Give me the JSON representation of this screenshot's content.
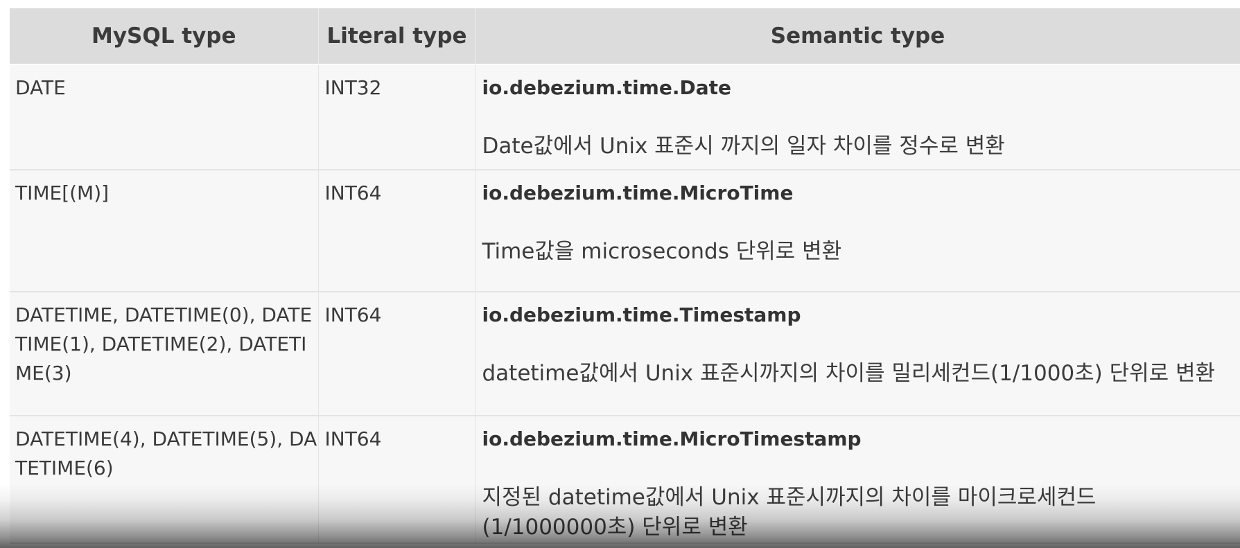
{
  "table": {
    "headers": {
      "mysql_type": "MySQL type",
      "literal_type": "Literal type",
      "semantic_type": "Semantic type"
    },
    "rows": [
      {
        "mysql_type": "DATE",
        "literal_type": "INT32",
        "semantic_name": "io.debezium.time.Date",
        "semantic_desc": "Date값에서 Unix 표준시 까지의 일자 차이를 정수로 변환"
      },
      {
        "mysql_type": "TIME[(M)]",
        "literal_type": "INT64",
        "semantic_name": "io.debezium.time.MicroTime",
        "semantic_desc": "Time값을 microseconds 단위로 변환"
      },
      {
        "mysql_type": "DATETIME, DATETIME(0), DATETIME(1), DATETIME(2), DATETIME(3)",
        "literal_type": "INT64",
        "semantic_name": "io.debezium.time.Timestamp",
        "semantic_desc": "datetime값에서 Unix 표준시까지의 차이를 밀리세컨드(1/1000초) 단위로 변환"
      },
      {
        "mysql_type": "DATETIME(4), DATETIME(5), DATETIME(6)",
        "literal_type": "INT64",
        "semantic_name": "io.debezium.time.MicroTimestamp",
        "semantic_desc": "지정된 datetime값에서 Unix 표준시까지의 차이를 마이크로세컨드(1/1000000초) 단위로 변환"
      }
    ]
  }
}
